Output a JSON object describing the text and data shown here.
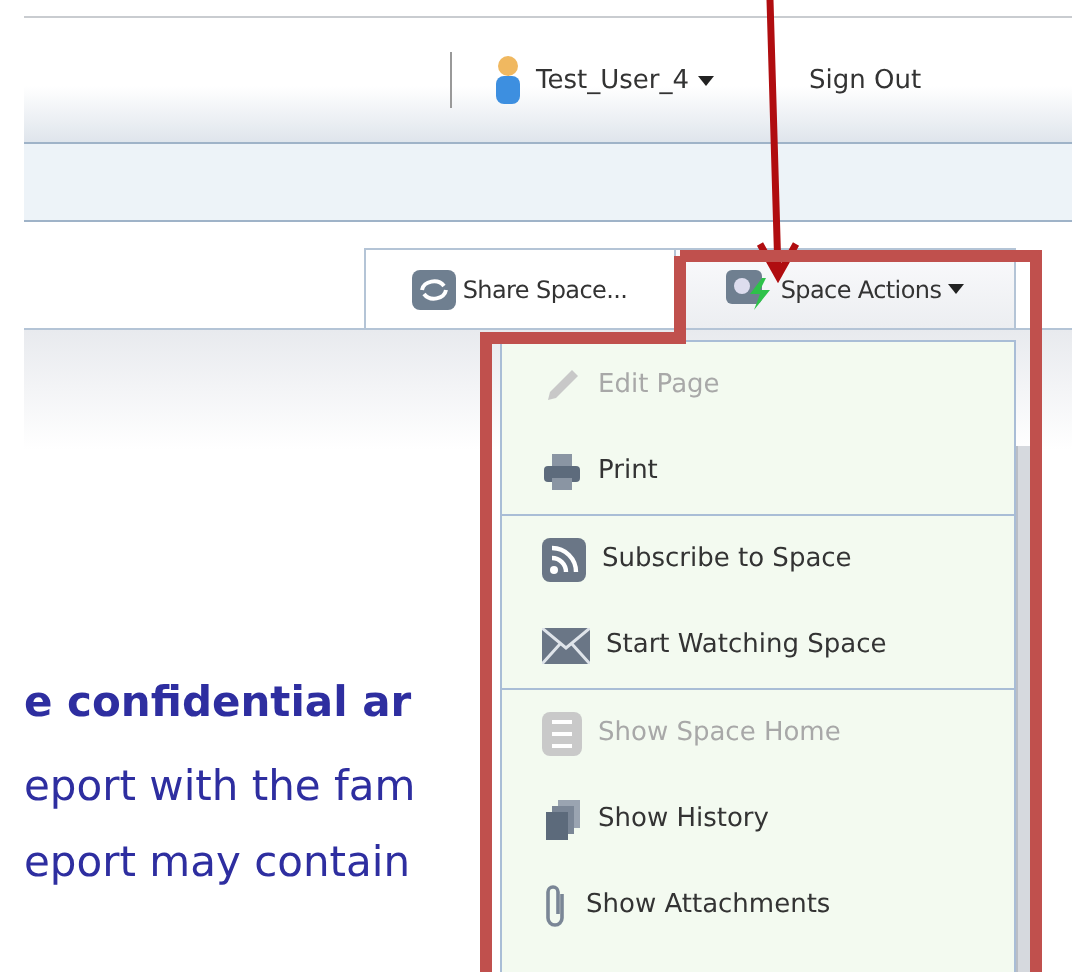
{
  "header": {
    "user_name": "Test_User_4",
    "sign_out": "Sign Out"
  },
  "tabs": [
    {
      "label": "Share Space...",
      "kind": "share"
    },
    {
      "label": "Space Actions",
      "kind": "actions"
    }
  ],
  "content": {
    "lines": [
      {
        "text": "e confidential ar",
        "bold": true
      },
      {
        "text": "eport with the fam",
        "bold": false
      },
      {
        "text": "eport may contain",
        "bold": false
      }
    ]
  },
  "menu": {
    "groups": [
      [
        {
          "label": "Edit Page",
          "kind": "edit",
          "disabled": true
        },
        {
          "label": "Print",
          "kind": "print",
          "disabled": false
        }
      ],
      [
        {
          "label": "Subscribe to Space",
          "kind": "subscribe",
          "disabled": false
        },
        {
          "label": "Start Watching Space",
          "kind": "watch",
          "disabled": false
        }
      ],
      [
        {
          "label": "Show Space Home",
          "kind": "home",
          "disabled": true
        },
        {
          "label": "Show History",
          "kind": "history",
          "disabled": false
        },
        {
          "label": "Show Attachments",
          "kind": "attachments",
          "disabled": false
        }
      ]
    ]
  },
  "annotations": [
    {
      "kind": "arrow"
    },
    {
      "kind": "frame"
    }
  ]
}
